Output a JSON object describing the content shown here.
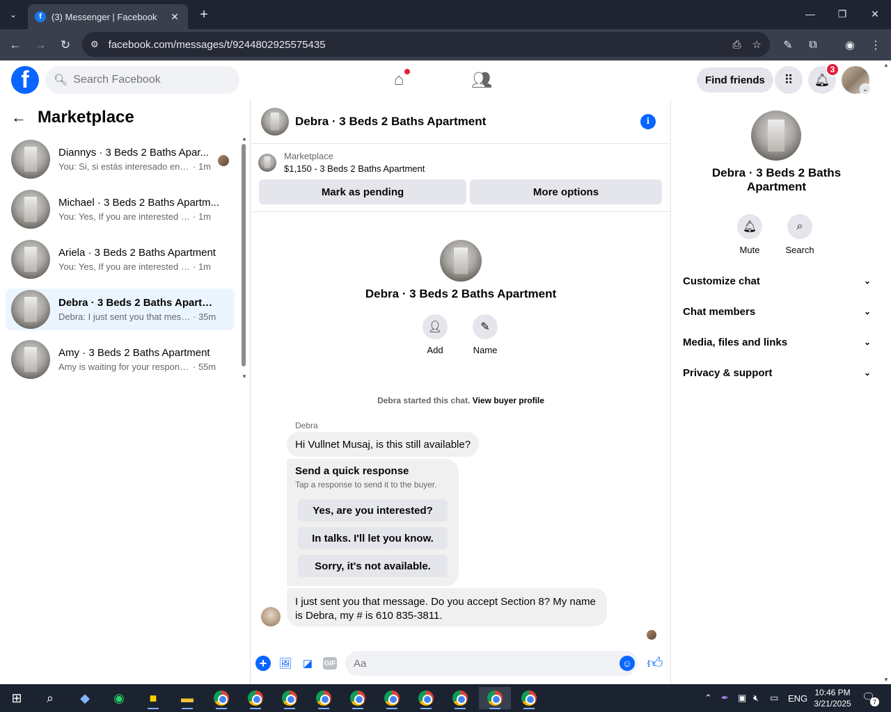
{
  "browser": {
    "tab_title": "(3) Messenger | Facebook",
    "url": "facebook.com/messages/t/9244802925575435"
  },
  "header": {
    "search_placeholder": "Search Facebook",
    "find_friends": "Find friends",
    "notification_count": "3"
  },
  "left": {
    "title": "Marketplace",
    "conversations": [
      {
        "name": "Diannys · 3 Beds 2 Baths Apar...",
        "snippet": "You: Si, si estás interesado envía...",
        "time": "· 1m",
        "active": false
      },
      {
        "name": "Michael · 3 Beds 2 Baths Apartm...",
        "snippet": "You: Yes, If you are interested then...",
        "time": "· 1m",
        "active": false
      },
      {
        "name": "Ariela · 3 Beds 2 Baths Apartment",
        "snippet": "You: Yes, If you are interested then...",
        "time": "· 1m",
        "active": false
      },
      {
        "name": "Debra · 3 Beds 2 Baths Apartment",
        "snippet": "Debra: I just sent you that messa...",
        "time": "· 35m",
        "active": true
      },
      {
        "name": "Amy · 3 Beds 2 Baths Apartment",
        "snippet": "Amy is waiting for your response.",
        "time": "· 55m",
        "active": false
      }
    ]
  },
  "chat": {
    "title": "Debra · 3 Beds 2 Baths Apartment",
    "listing_label": "Marketplace",
    "listing_price": "$1,150 - 3 Beds 2 Baths Apartment",
    "mark_pending": "Mark as pending",
    "more_options": "More options",
    "center_name": "Debra · 3 Beds 2 Baths Apartment",
    "add_label": "Add",
    "name_label": "Name",
    "started_text": "Debra started this chat.",
    "view_profile": "View buyer profile",
    "sender": "Debra",
    "msg1": "Hi Vullnet Musaj, is this still available?",
    "quick_title": "Send a quick response",
    "quick_sub": "Tap a response to send it to the buyer.",
    "quick_options": [
      "Yes, are you interested?",
      "In talks. I'll let you know.",
      "Sorry, it's not available."
    ],
    "msg2": "I just sent you that message. Do you accept Section 8? My name is Debra, my # is 610 835-3811.",
    "composer_placeholder": "Aa",
    "gif_label": "GIF"
  },
  "right": {
    "name": "Debra · 3 Beds 2 Baths Apartment",
    "mute": "Mute",
    "search": "Search",
    "sections": [
      "Customize chat",
      "Chat members",
      "Media, files and links",
      "Privacy & support"
    ]
  },
  "taskbar": {
    "lang": "ENG",
    "time": "10:46 PM",
    "date": "3/21/2025",
    "notif_count": "7"
  }
}
